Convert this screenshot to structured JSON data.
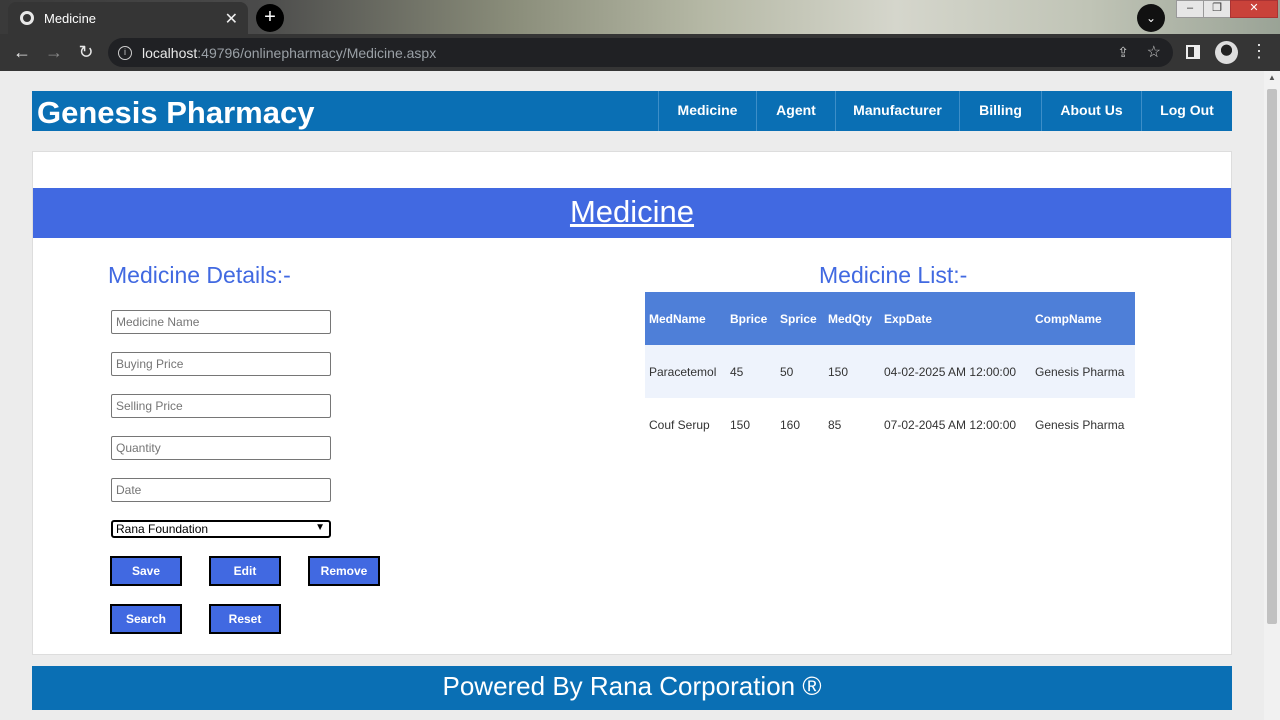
{
  "browser": {
    "tab_title": "Medicine",
    "url_host": "localhost",
    "url_path": ":49796/onlinepharmacy/Medicine.aspx"
  },
  "site": {
    "brand": "Genesis Pharmacy",
    "nav": [
      {
        "label": "Medicine"
      },
      {
        "label": "Agent"
      },
      {
        "label": "Manufacturer"
      },
      {
        "label": "Billing"
      },
      {
        "label": "About Us"
      },
      {
        "label": "Log Out"
      }
    ]
  },
  "page": {
    "banner_title": "Medicine",
    "form_title": "Medicine Details:-",
    "list_title": "Medicine List:-"
  },
  "form": {
    "medicine_name_placeholder": "Medicine Name",
    "buying_price_placeholder": "Buying Price",
    "selling_price_placeholder": "Selling Price",
    "quantity_placeholder": "Quantity",
    "date_placeholder": "Date",
    "company_selected": "Rana Foundation",
    "buttons": {
      "save": "Save",
      "edit": "Edit",
      "remove": "Remove",
      "search": "Search",
      "reset": "Reset"
    }
  },
  "table": {
    "headers": [
      "MedName",
      "Bprice",
      "Sprice",
      "MedQty",
      "ExpDate",
      "CompName"
    ],
    "rows": [
      [
        "Paracetemol",
        "45",
        "50",
        "150",
        "04-02-2025 AM 12:00:00",
        "Genesis Pharma"
      ],
      [
        "Couf Serup",
        "150",
        "160",
        "85",
        "07-02-2045 AM 12:00:00",
        "Genesis Pharma"
      ]
    ]
  },
  "footer": {
    "text": "Powered By Rana Corporation ®"
  },
  "colors": {
    "header_blue": "#0a6fb4",
    "accent_royal_blue": "#4169e1",
    "table_header": "#4e7fd8"
  }
}
